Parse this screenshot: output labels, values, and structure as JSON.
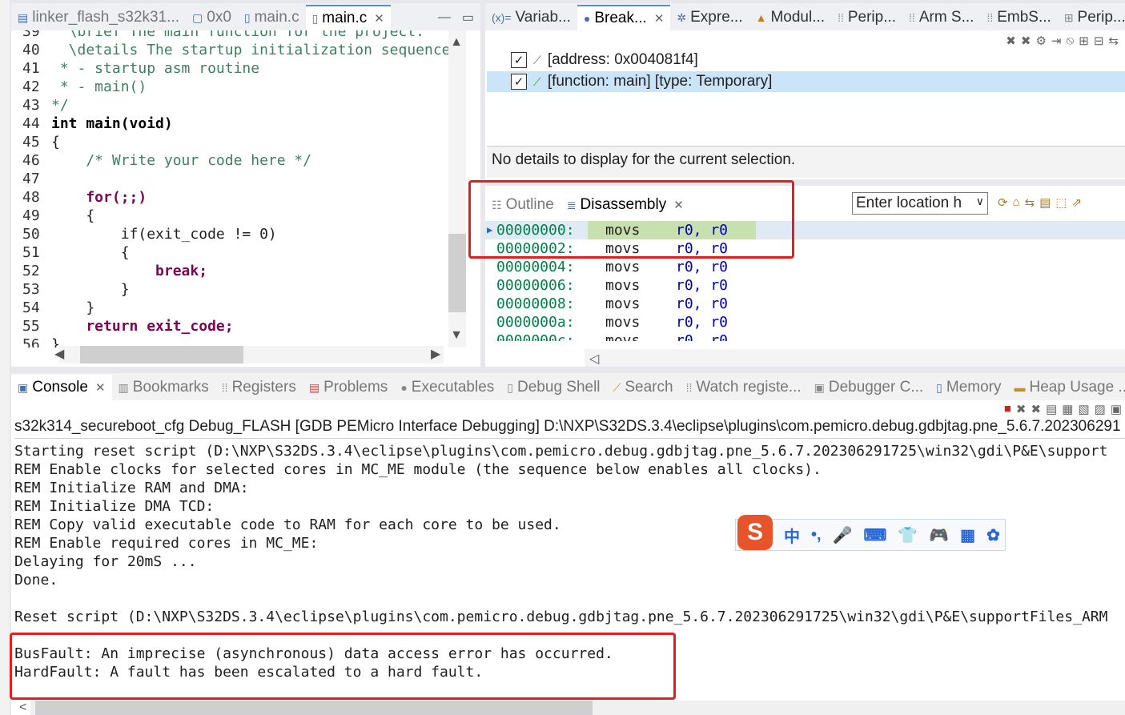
{
  "editor": {
    "tabs": [
      {
        "label": "linker_flash_s32k31...",
        "icon": "linker-file-icon",
        "active": false
      },
      {
        "label": "0x0",
        "icon": "memory-icon",
        "active": false
      },
      {
        "label": "main.c",
        "icon": "c-file-icon",
        "active": false
      },
      {
        "label": "main.c",
        "icon": "c-file-icon",
        "active": true
      }
    ],
    "lines": [
      {
        "num": "39",
        "text": "  \\brief The main function for the project."
      },
      {
        "num": "40",
        "text": "  \\details The startup initialization sequence"
      },
      {
        "num": "41",
        "text": " * - startup asm routine"
      },
      {
        "num": "42",
        "text": " * - main()"
      },
      {
        "num": "43",
        "text": "*/"
      },
      {
        "num": "44",
        "text": "int main(void)"
      },
      {
        "num": "45",
        "text": "{"
      },
      {
        "num": "46",
        "text": "    /* Write your code here */"
      },
      {
        "num": "47",
        "text": ""
      },
      {
        "num": "48",
        "text": "    for(;;)"
      },
      {
        "num": "49",
        "text": "    {"
      },
      {
        "num": "50",
        "text": "        if(exit_code != 0)"
      },
      {
        "num": "51",
        "text": "        {"
      },
      {
        "num": "52",
        "text": "            break;"
      },
      {
        "num": "53",
        "text": "        }"
      },
      {
        "num": "54",
        "text": "    }"
      },
      {
        "num": "55",
        "text": "    return exit_code;"
      },
      {
        "num": "56",
        "text": "}"
      }
    ]
  },
  "debug_views": {
    "tabs": [
      {
        "label": "Variab...",
        "icon": "variables-icon",
        "active": false
      },
      {
        "label": "Break...",
        "icon": "breakpoints-icon",
        "active": true
      },
      {
        "label": "Expre...",
        "icon": "expressions-icon",
        "active": false
      },
      {
        "label": "Modul...",
        "icon": "modules-icon",
        "active": false
      },
      {
        "label": "Perip...",
        "icon": "peripherals-icon",
        "active": false
      },
      {
        "label": "Arm S...",
        "icon": "arm-icon",
        "active": false
      },
      {
        "label": "EmbS...",
        "icon": "embsys-icon",
        "active": false
      },
      {
        "label": "Perip...",
        "icon": "peripherals-icon",
        "active": false
      }
    ],
    "breakpoints": [
      {
        "label": "[address: 0x004081f4]",
        "checked": true,
        "selected": false
      },
      {
        "label": "[function: main] [type: Temporary]",
        "checked": true,
        "selected": true
      }
    ],
    "details_text": "No details to display for the current selection."
  },
  "disassembly": {
    "tabs": [
      {
        "label": "Outline",
        "icon": "outline-icon",
        "active": false
      },
      {
        "label": "Disassembly",
        "icon": "disassembly-icon",
        "active": true
      }
    ],
    "location_placeholder": "Enter location h",
    "rows": [
      {
        "addr": "00000000:",
        "mnemonic": "movs",
        "operands": "r0, r0",
        "current": true
      },
      {
        "addr": "00000002:",
        "mnemonic": "movs",
        "operands": "r0, r0",
        "current": false
      },
      {
        "addr": "00000004:",
        "mnemonic": "movs",
        "operands": "r0, r0",
        "current": false
      },
      {
        "addr": "00000006:",
        "mnemonic": "movs",
        "operands": "r0, r0",
        "current": false
      },
      {
        "addr": "00000008:",
        "mnemonic": "movs",
        "operands": "r0, r0",
        "current": false
      },
      {
        "addr": "0000000a:",
        "mnemonic": "movs",
        "operands": "r0, r0",
        "current": false
      },
      {
        "addr": "0000000c:",
        "mnemonic": "movs",
        "operands": "r0, r0",
        "current": false
      }
    ]
  },
  "console": {
    "tabs": [
      {
        "label": "Console",
        "icon": "console-icon",
        "active": true
      },
      {
        "label": "Bookmarks",
        "icon": "bookmarks-icon",
        "active": false
      },
      {
        "label": "Registers",
        "icon": "registers-icon",
        "active": false
      },
      {
        "label": "Problems",
        "icon": "problems-icon",
        "active": false
      },
      {
        "label": "Executables",
        "icon": "executables-icon",
        "active": false
      },
      {
        "label": "Debug Shell",
        "icon": "debug-shell-icon",
        "active": false
      },
      {
        "label": "Search",
        "icon": "search-icon",
        "active": false
      },
      {
        "label": "Watch registe...",
        "icon": "watch-registers-icon",
        "active": false
      },
      {
        "label": "Debugger C...",
        "icon": "debugger-console-icon",
        "active": false
      },
      {
        "label": "Memory",
        "icon": "memory-icon",
        "active": false
      },
      {
        "label": "Heap Usage ...",
        "icon": "heap-usage-icon",
        "active": false
      }
    ],
    "description": "s32k314_secureboot_cfg Debug_FLASH [GDB PEMicro Interface Debugging] D:\\NXP\\S32DS.3.4\\eclipse\\plugins\\com.pemicro.debug.gdbjtag.pne_5.6.7.202306291",
    "lines": [
      "Starting reset script (D:\\NXP\\S32DS.3.4\\eclipse\\plugins\\com.pemicro.debug.gdbjtag.pne_5.6.7.202306291725\\win32\\gdi\\P&E\\support",
      "REM Enable clocks for selected cores in MC_ME module (the sequence below enables all clocks).",
      "REM Initialize RAM and DMA:",
      "REM Initialize DMA TCD:",
      "REM Copy valid executable code to RAM for each core to be used.",
      "REM Enable required cores in MC_ME:",
      "Delaying for 20mS ...",
      "Done.",
      "",
      "Reset script (D:\\NXP\\S32DS.3.4\\eclipse\\plugins\\com.pemicro.debug.gdbjtag.pne_5.6.7.202306291725\\win32\\gdi\\P&E\\supportFiles_ARM",
      "",
      "BusFault: An imprecise (asynchronous) data access error has occurred.",
      "HardFault: A fault has been escalated to a hard fault."
    ]
  },
  "ime": {
    "logo": "S",
    "items": [
      {
        "label": "中",
        "icon": "chinese-mode-icon"
      },
      {
        "label": "•,",
        "icon": "punctuation-icon"
      },
      {
        "label": "🎤",
        "icon": "microphone-icon"
      },
      {
        "label": "⌨",
        "icon": "keyboard-icon"
      },
      {
        "label": "👕",
        "icon": "skin-icon"
      },
      {
        "label": "🎮",
        "icon": "game-icon"
      },
      {
        "label": "▦",
        "icon": "toolbox-icon"
      },
      {
        "label": "✿",
        "icon": "settings-icon"
      }
    ]
  },
  "colors": {
    "annotation_red": "#e02020",
    "current_instruction": "#c8e0b0",
    "selected_row": "#cce4f7",
    "address_green": "#00804a"
  }
}
